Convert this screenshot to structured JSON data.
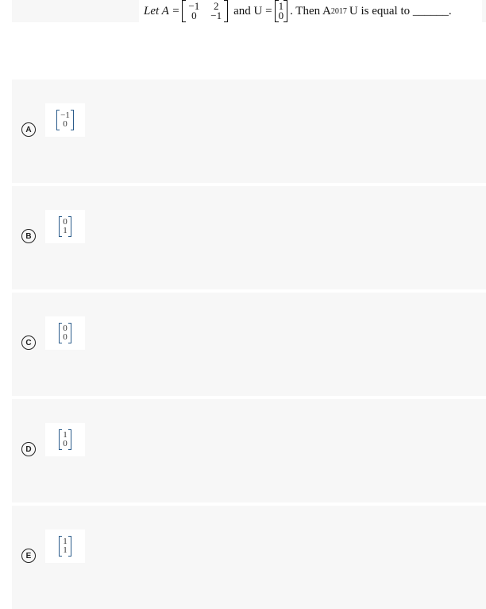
{
  "question": {
    "prefix": "Let A =",
    "matrix_a": [
      [
        "−1",
        "2"
      ],
      [
        "0",
        "−1"
      ]
    ],
    "mid": "and U =",
    "vector_u": [
      "1",
      "0"
    ],
    "suffix": ". Then A",
    "exponent": "2017",
    "suffix2": "U is equal to ______."
  },
  "options": [
    {
      "letter": "A",
      "vector": [
        "−1",
        "0"
      ]
    },
    {
      "letter": "B",
      "vector": [
        "0",
        "1"
      ]
    },
    {
      "letter": "C",
      "vector": [
        "0",
        "0"
      ]
    },
    {
      "letter": "D",
      "vector": [
        "1",
        "0"
      ]
    },
    {
      "letter": "E",
      "vector": [
        "1",
        "1"
      ]
    }
  ]
}
